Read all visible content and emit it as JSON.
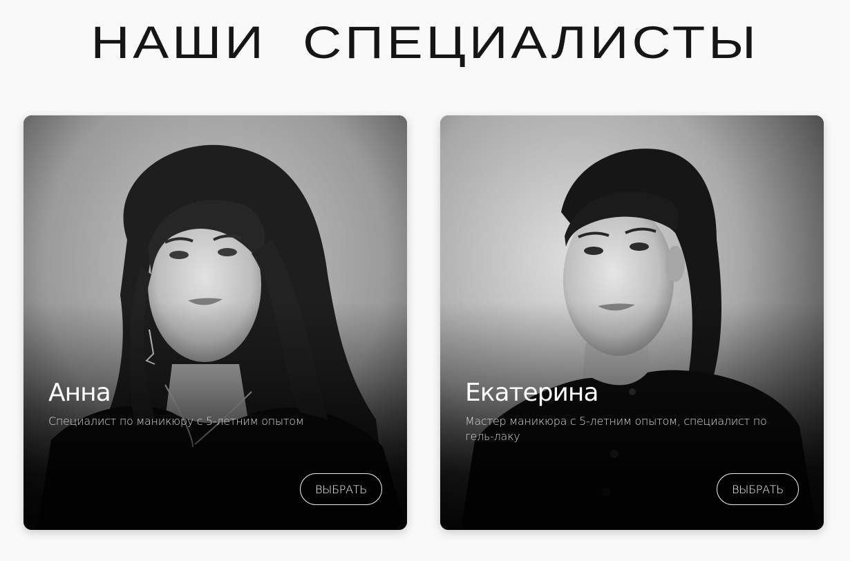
{
  "page": {
    "title": "НАШИ СПЕЦИАЛИСТЫ"
  },
  "specialists": [
    {
      "name": "Анна",
      "description": "Специалист по маникюру с 5-летним опытом",
      "button_label": "ВЫБРАТЬ"
    },
    {
      "name": "Екатерина",
      "description": "Мастер маникюра с 5-летним опытом, специалист по гель-лаку",
      "button_label": "ВЫБРАТЬ"
    }
  ]
}
